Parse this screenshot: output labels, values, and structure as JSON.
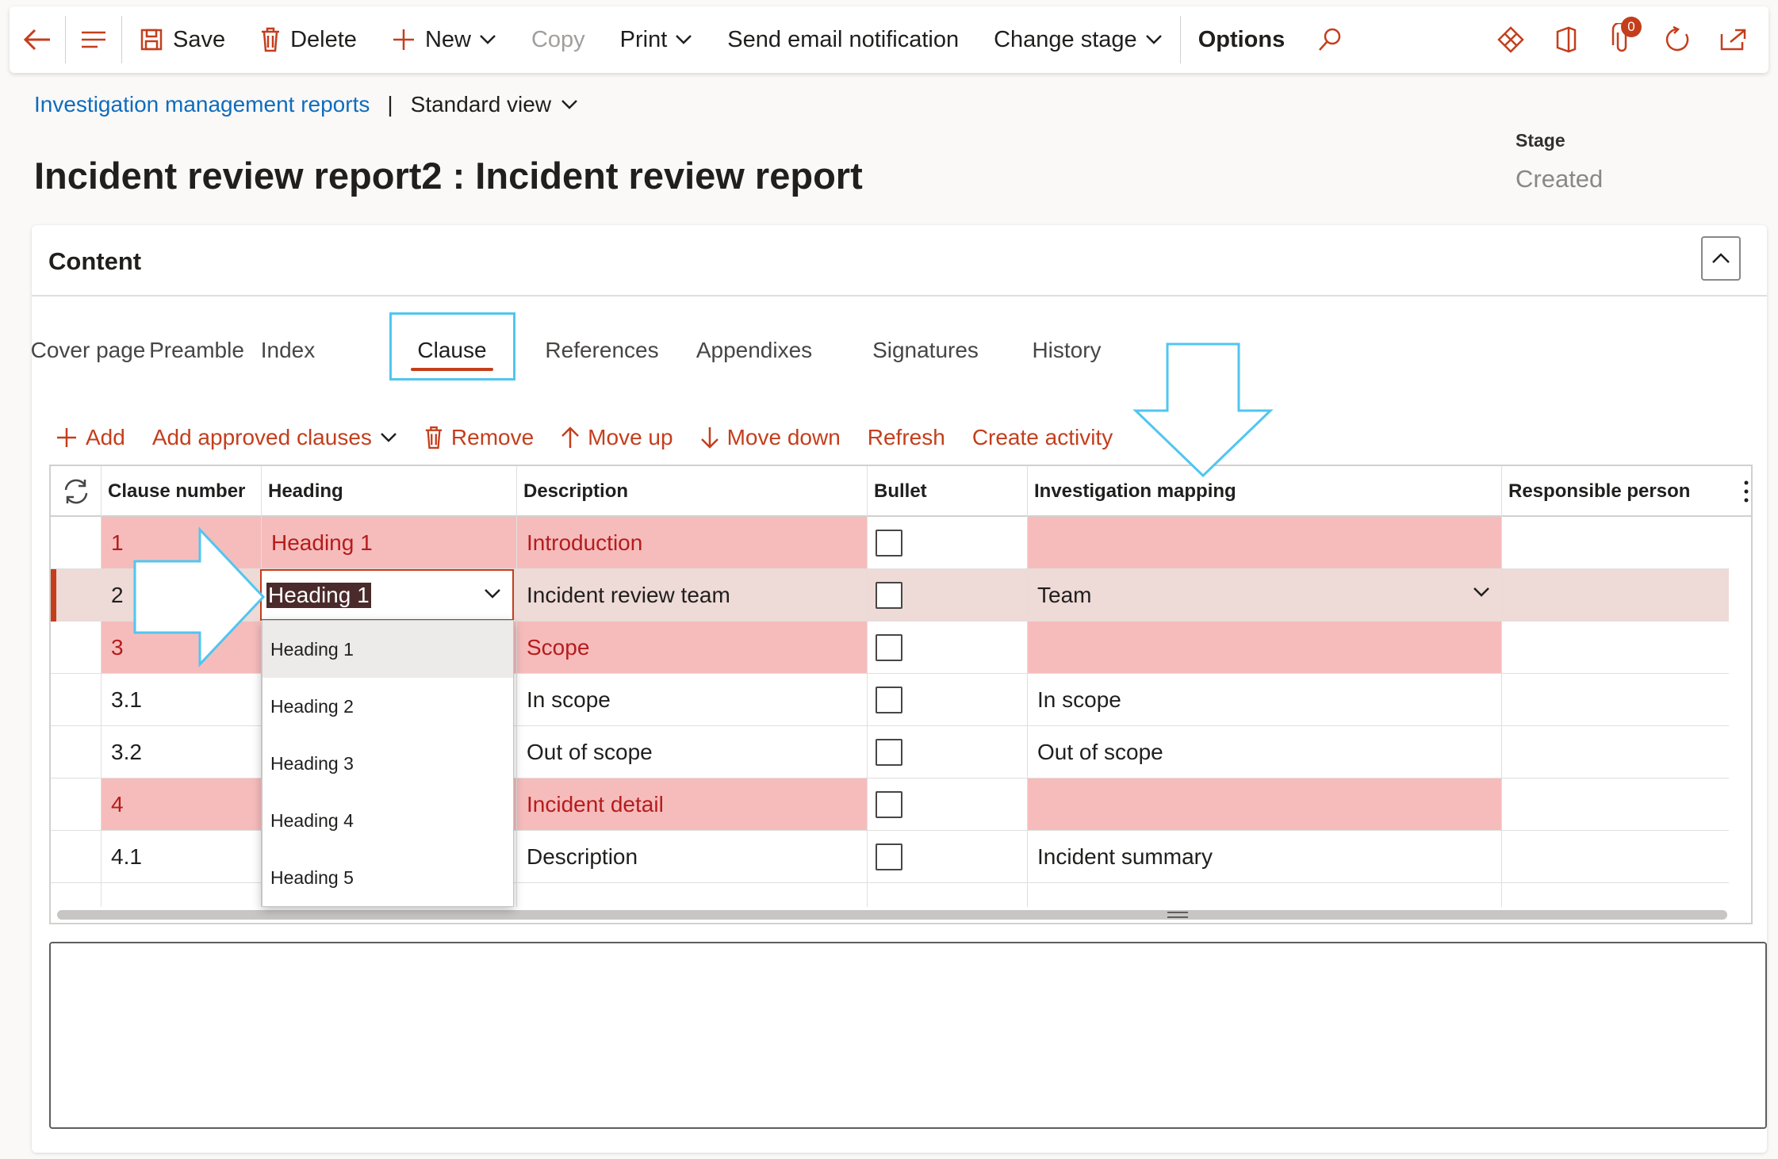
{
  "actionbar": {
    "save": "Save",
    "delete": "Delete",
    "new": "New",
    "copy": "Copy",
    "print": "Print",
    "send_email": "Send email notification",
    "change_stage": "Change stage",
    "options": "Options",
    "notification_count": "0"
  },
  "breadcrumb": {
    "link": "Investigation management reports",
    "separator": "|",
    "view": "Standard view"
  },
  "page_title": "Incident review report2 : Incident review report",
  "stage": {
    "label": "Stage",
    "value": "Created"
  },
  "content": {
    "title": "Content",
    "tabs": [
      "Cover page",
      "Preamble",
      "Index",
      "Clause",
      "References",
      "Appendixes",
      "Signatures",
      "History"
    ],
    "active_tab": "Clause",
    "toolbar": {
      "add": "Add",
      "add_approved": "Add approved clauses",
      "remove": "Remove",
      "move_up": "Move up",
      "move_down": "Move down",
      "refresh": "Refresh",
      "create_activity": "Create activity"
    },
    "grid": {
      "columns": {
        "clause_number": "Clause number",
        "heading": "Heading",
        "description": "Description",
        "bullet": "Bullet",
        "investigation_mapping": "Investigation mapping",
        "responsible_person": "Responsible person"
      },
      "rows": [
        {
          "clause_number": "1",
          "heading": "Heading 1",
          "description": "Introduction",
          "mapping": ""
        },
        {
          "clause_number": "2",
          "heading": "Heading 1",
          "description": "Incident review team",
          "mapping": "Team"
        },
        {
          "clause_number": "3",
          "heading": "",
          "description": "Scope",
          "mapping": ""
        },
        {
          "clause_number": "3.1",
          "heading": "",
          "description": "In scope",
          "mapping": "In scope"
        },
        {
          "clause_number": "3.2",
          "heading": "",
          "description": "Out of scope",
          "mapping": "Out of scope"
        },
        {
          "clause_number": "4",
          "heading": "",
          "description": "Incident detail",
          "mapping": ""
        },
        {
          "clause_number": "4.1",
          "heading": "",
          "description": "Description",
          "mapping": "Incident summary"
        }
      ]
    },
    "heading_options": [
      "Heading 1",
      "Heading 2",
      "Heading 3",
      "Heading 4",
      "Heading 5"
    ]
  },
  "colors": {
    "accent": "#c43e1c",
    "link": "#0f6cbd",
    "highlight_row": "#f6bcbc",
    "selected_row": "#eedad6",
    "annotation": "#50c6f0"
  }
}
